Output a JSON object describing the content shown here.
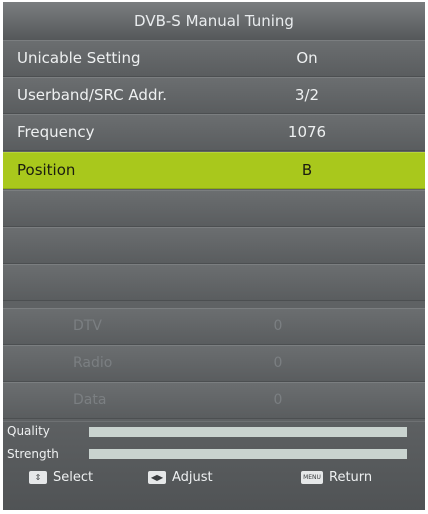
{
  "title": "DVB-S Manual Tuning",
  "settings": [
    {
      "label": "Unicable Setting",
      "value": "On"
    },
    {
      "label": "Userband/SRC Addr.",
      "value": "3/2"
    },
    {
      "label": "Frequency",
      "value": "1076"
    },
    {
      "label": "Position",
      "value": "B"
    }
  ],
  "counts": [
    {
      "label": "DTV",
      "value": "0"
    },
    {
      "label": "Radio",
      "value": "0"
    },
    {
      "label": "Data",
      "value": "0"
    }
  ],
  "meters": {
    "quality_label": "Quality",
    "strength_label": "Strength",
    "quality_level": 1.0,
    "strength_level": 1.0
  },
  "help": {
    "select": "Select",
    "adjust": "Adjust",
    "return": "Return",
    "updown_icon": "up-down-arrows-icon",
    "leftright_icon": "left-right-arrows-icon",
    "menu_icon": "menu-key-icon",
    "menu_key_text": "MENU"
  },
  "colors": {
    "highlight": "#a9c81c",
    "panel": "#5f6264",
    "meter": "#c9d3cf"
  }
}
